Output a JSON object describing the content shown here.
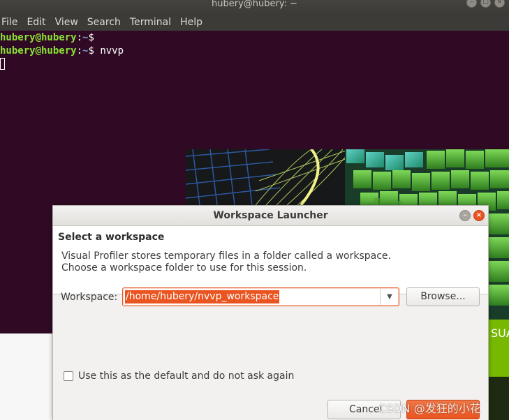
{
  "terminal": {
    "title": "hubery@hubery: ~",
    "menu": [
      "File",
      "Edit",
      "View",
      "Search",
      "Terminal",
      "Help"
    ],
    "lines": [
      {
        "user": "hubery@hubery",
        "path": "~",
        "cmd": ""
      },
      {
        "user": "hubery@hubery",
        "path": "~",
        "cmd": " nvvp"
      }
    ],
    "colors": {
      "background": "#300a24",
      "user": "#8ae234",
      "path": "#729fcf"
    }
  },
  "splash": {
    "partial_text": "SUA"
  },
  "dialog": {
    "title": "Workspace Launcher",
    "heading": "Select a workspace",
    "description_line1": "Visual Profiler stores temporary files in a folder called a workspace.",
    "description_line2": "Choose a workspace folder to use for this session.",
    "workspace_label": "Workspace:",
    "workspace_value": "/home/hubery/nvvp_workspace",
    "browse_label": "Browse...",
    "checkbox_label": "Use this as the default and do not ask again",
    "checkbox_checked": false,
    "cancel_label": "Cancel",
    "accent_color": "#e95420"
  },
  "watermark": "CSDN @发狂的小花"
}
